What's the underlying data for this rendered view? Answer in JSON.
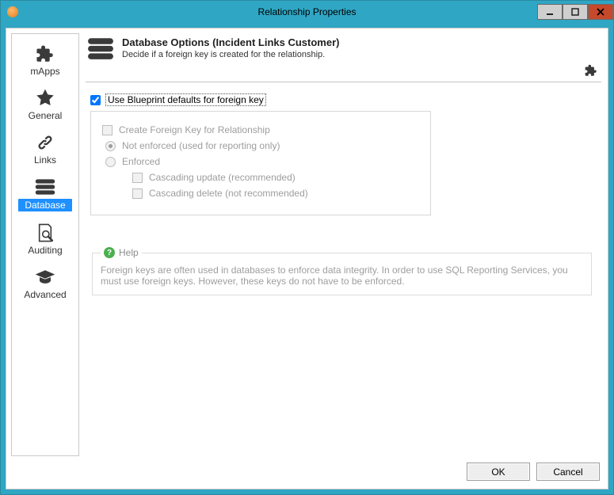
{
  "window": {
    "title": "Relationship Properties"
  },
  "sidebar": {
    "items": [
      {
        "id": "mapps",
        "label": "mApps",
        "icon": "puzzle-icon"
      },
      {
        "id": "general",
        "label": "General",
        "icon": "star-icon"
      },
      {
        "id": "links",
        "label": "Links",
        "icon": "link-icon"
      },
      {
        "id": "database",
        "label": "Database",
        "icon": "database-icon",
        "selected": true
      },
      {
        "id": "auditing",
        "label": "Auditing",
        "icon": "audit-icon"
      },
      {
        "id": "advanced",
        "label": "Advanced",
        "icon": "gradcap-icon"
      }
    ]
  },
  "header": {
    "title": "Database Options  (Incident Links Customer)",
    "subtitle": "Decide if a foreign key is created for the relationship."
  },
  "options": {
    "use_blueprint_defaults": {
      "label": "Use Blueprint defaults for foreign key",
      "checked": true
    },
    "create_fk_label": "Create Foreign Key for Relationship",
    "not_enforced_label": "Not enforced (used for reporting only)",
    "enforced_label": "Enforced",
    "cascading_update_label": "Cascading update (recommended)",
    "cascading_delete_label": "Cascading delete (not recommended)"
  },
  "help": {
    "legend": "Help",
    "text": "Foreign keys are often used in databases to enforce data integrity.  In order to use SQL Reporting Services, you must use foreign keys.  However, these keys do not have to be enforced."
  },
  "footer": {
    "ok": "OK",
    "cancel": "Cancel"
  }
}
